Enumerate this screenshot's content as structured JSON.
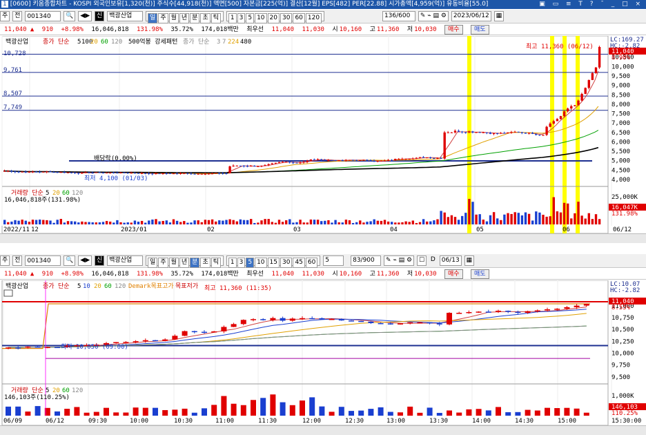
{
  "titlebar": {
    "number": "1",
    "text": "[0600] 키움종합차트 - KOSPI 외국인보유[1,320(천)] 주식수[44,918(천)] 액면[500] 자본금[225(억)] 결산[12월] EPS[482] PER[22.88] 시가총액[4,959(억)] 유동비율[55.0]",
    "controls": "▣ ▭ ≡ T ? ˉ _ □ ×"
  },
  "top": {
    "toolbar": {
      "mode1": "주",
      "mode2": "전",
      "code": "001340",
      "icon_sin": "신",
      "name": "백광산업",
      "periods": [
        "일",
        "주",
        "월",
        "년",
        "분",
        "초",
        "틱"
      ],
      "active": "일",
      "nums": [
        "1",
        "3",
        "5",
        "10",
        "20",
        "30",
        "60",
        "120"
      ],
      "count": "136/600",
      "date": "2023/06/12"
    },
    "quote": {
      "price": "11,040 ▲",
      "change": "910",
      "rate": "+8.98%",
      "volume": "16,046,818",
      "vol_rate": "131.98%",
      "turnover": "35.72%",
      "amount": "174,018백만",
      "best": "최우선",
      "ask": "11,040",
      "bid": "11,030",
      "open_l": "시",
      "open": "10,160",
      "high_l": "고",
      "high": "11,360",
      "low_l": "저",
      "low": "10,030",
      "buy": "매수",
      "sell": "매도"
    },
    "legend": {
      "name": "백광산업",
      "ma_label": "종가 단순",
      "ma": [
        "5",
        "100",
        "20",
        "60",
        "120"
      ],
      "p500": "500억봉 강세패턴",
      "ma2": "종가 단순",
      "ma2v": [
        "3",
        "7",
        "224",
        "480"
      ]
    },
    "levels": [
      "10,728",
      "9,761",
      "8,507",
      "7,749"
    ],
    "annot": {
      "high": "최고 11,360 (06/12)",
      "low": "최저 4,100 (01/03)",
      "div": "배당락(0.00%)"
    },
    "yaxis": [
      "10,500",
      "10,000",
      "9,500",
      "9,000",
      "8,500",
      "8,000",
      "7,500",
      "7,000",
      "6,500",
      "6,000",
      "5,500",
      "5,000",
      "4,500",
      "4,000"
    ],
    "side": {
      "lc": "LC:169.27",
      "hc": "HC:-2.82",
      "cur": "11,040",
      "pct": "8.98%"
    },
    "vol": {
      "title": "거래량 단순",
      "v": [
        "5",
        "20",
        "60",
        "120"
      ],
      "sum": "16,046,818주(131.98%)",
      "axis": "25,000K",
      "cur": "16,047K",
      "pct": "131.98%"
    },
    "xaxis": [
      "2022/11",
      "12",
      "2023/01",
      "02",
      "03",
      "04",
      "05",
      "06",
      "06/12"
    ]
  },
  "bottom": {
    "toolbar": {
      "mode1": "주",
      "mode2": "전",
      "code": "001340",
      "icon_sin": "신",
      "name": "백광산업",
      "periods": [
        "일",
        "주",
        "월",
        "년",
        "분",
        "초",
        "틱"
      ],
      "active": "분",
      "nums": [
        "1",
        "3",
        "5",
        "10",
        "15",
        "30",
        "45",
        "60"
      ],
      "active_num": "5",
      "n": "5",
      "count": "83/900",
      "date": "06/13",
      "dlabel": "D"
    },
    "quote": {
      "price": "11,040 ▲",
      "change": "910",
      "rate": "+8.98%",
      "volume": "16,046,818",
      "vol_rate": "131.98%",
      "turnover": "35.72%",
      "amount": "174,018백만",
      "best": "최우선",
      "ask": "11,040",
      "bid": "11,030",
      "open_l": "시",
      "open": "10,160",
      "high_l": "고",
      "high": "11,360",
      "low_l": "저",
      "low": "10,030",
      "buy": "매수",
      "sell": "매도"
    },
    "legend": {
      "name": "백광산업",
      "ma_label": "종가 단순",
      "ma": [
        "5",
        "10",
        "20",
        "60",
        "120"
      ],
      "demark": "Demark목표고가",
      "demark2": "목표저가"
    },
    "annot": {
      "high": "최고 11,360 (11:35)",
      "low": "최저 10,050 (09:00)"
    },
    "yaxis": [
      "11,000",
      "10,750",
      "10,500",
      "10,250",
      "10,000",
      "9,750",
      "9,500"
    ],
    "side": {
      "lc": "LC:10.07",
      "hc": "HC:-2.82",
      "cur": "11,040",
      "pct": "8.55%"
    },
    "vol": {
      "title": "거래량 단순",
      "v": [
        "5",
        "20",
        "60",
        "120"
      ],
      "sum": "146,103주(110.25%)",
      "axis": "1,000K",
      "cur": "146,103",
      "pct": "110.25%"
    },
    "xaxis": [
      "06/09",
      "06/12",
      "09:30",
      "10:00",
      "10:30",
      "11:00",
      "11:30",
      "12:00",
      "12:30",
      "13:00",
      "13:30",
      "14:00",
      "14:30",
      "15:00",
      "15:30:00"
    ]
  },
  "colors": {
    "up": "#e00000",
    "down": "#1a3fd0",
    "highlight": "#ffff00",
    "level": "#1d2f90"
  }
}
